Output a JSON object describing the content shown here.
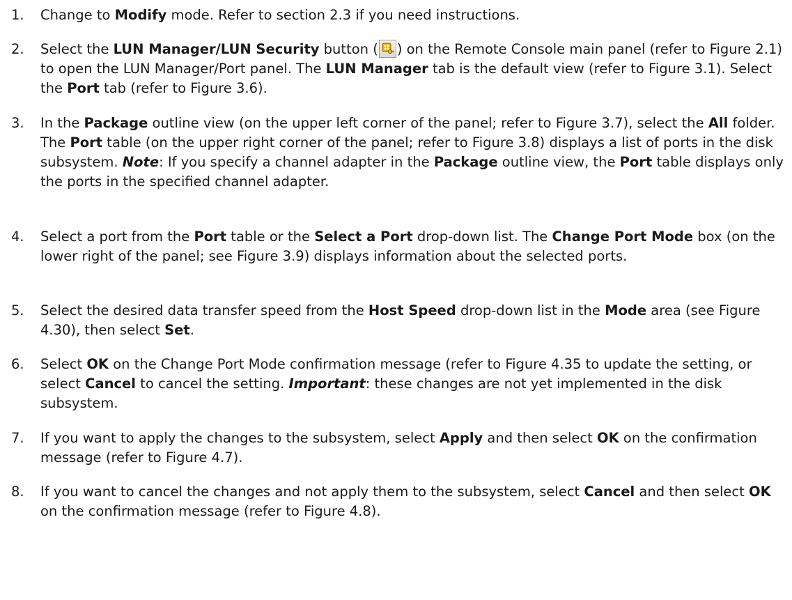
{
  "steps": [
    {
      "number": "1.",
      "segments": [
        {
          "text": "Change to "
        },
        {
          "text": "Modify",
          "style": "bold"
        },
        {
          "text": " mode. Refer to section 2.3 if you need instructions."
        }
      ]
    },
    {
      "number": "2.",
      "segments": [
        {
          "text": "Select the "
        },
        {
          "text": "LUN Manager/LUN Security",
          "style": "bold"
        },
        {
          "text": " button ("
        },
        {
          "icon": "lun-manager-key-icon"
        },
        {
          "text": ") on the Remote Console main panel (refer to Figure 2.1) to open the LUN Manager/Port panel. The "
        },
        {
          "text": "LUN Manager",
          "style": "bold"
        },
        {
          "text": " tab is the default view (refer to Figure 3.1). Select the "
        },
        {
          "text": "Port",
          "style": "bold"
        },
        {
          "text": " tab (refer to Figure 3.6)."
        }
      ]
    },
    {
      "number": "3.",
      "segments": [
        {
          "text": "In the "
        },
        {
          "text": "Package",
          "style": "bold"
        },
        {
          "text": " outline view (on the upper left corner of the panel; refer to Figure 3.7), select the "
        },
        {
          "text": "All",
          "style": "bold"
        },
        {
          "text": " folder. The "
        },
        {
          "text": "Port",
          "style": "bold"
        },
        {
          "text": " table (on the upper right corner of the panel; refer to Figure 3.8) displays a list of ports in the disk subsystem. "
        },
        {
          "text": "Note",
          "style": "bold-italic"
        },
        {
          "text": ": If you specify a channel adapter in the "
        },
        {
          "text": "Package",
          "style": "bold"
        },
        {
          "text": " outline view, the "
        },
        {
          "text": "Port",
          "style": "bold"
        },
        {
          "text": " table displays only the ports in the specified channel adapter."
        }
      ]
    },
    {
      "number": "4.",
      "segments": [
        {
          "text": "Select a port from the "
        },
        {
          "text": "Port",
          "style": "bold"
        },
        {
          "text": " table or the "
        },
        {
          "text": "Select a Port",
          "style": "bold"
        },
        {
          "text": " drop-down list. The "
        },
        {
          "text": "Change Port Mode",
          "style": "bold"
        },
        {
          "text": " box (on the lower right of the panel; see Figure 3.9) displays information about the selected ports."
        }
      ]
    },
    {
      "number": "5.",
      "segments": [
        {
          "text": "Select the desired data transfer speed from the "
        },
        {
          "text": "Host Speed",
          "style": "bold"
        },
        {
          "text": " drop-down list in the "
        },
        {
          "text": "Mode",
          "style": "bold"
        },
        {
          "text": " area (see Figure 4.30), then select "
        },
        {
          "text": "Set",
          "style": "bold"
        },
        {
          "text": "."
        }
      ]
    },
    {
      "number": "6.",
      "segments": [
        {
          "text": "Select "
        },
        {
          "text": "OK",
          "style": "bold"
        },
        {
          "text": " on the Change Port Mode confirmation message (refer to Figure 4.35 to update the setting, or select "
        },
        {
          "text": "Cancel",
          "style": "bold"
        },
        {
          "text": " to cancel the setting. "
        },
        {
          "text": "Important",
          "style": "bold-italic"
        },
        {
          "text": ": these changes are not yet implemented in the disk subsystem."
        }
      ]
    },
    {
      "number": "7.",
      "segments": [
        {
          "text": "If you want to apply the changes to the subsystem, select "
        },
        {
          "text": "Apply",
          "style": "bold"
        },
        {
          "text": " and then select "
        },
        {
          "text": "OK",
          "style": "bold"
        },
        {
          "text": " on the confirmation message (refer to Figure 4.7)."
        }
      ]
    },
    {
      "number": "8.",
      "segments": [
        {
          "text": "If you want to cancel the changes and not apply them to the subsystem, select "
        },
        {
          "text": "Cancel",
          "style": "bold"
        },
        {
          "text": " and then select "
        },
        {
          "text": "OK",
          "style": "bold"
        },
        {
          "text": " on the confirmation message (refer to Figure 4.8)."
        }
      ]
    }
  ]
}
